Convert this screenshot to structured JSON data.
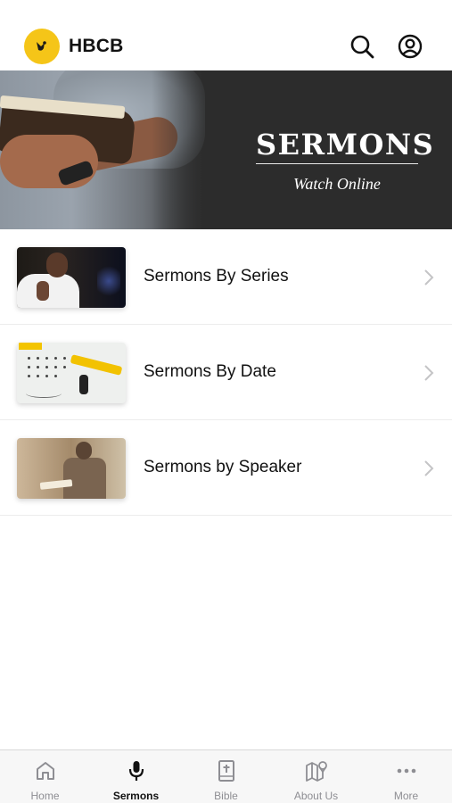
{
  "header": {
    "brand": "HBCB",
    "logo_icon": "bird-logo-icon",
    "search_icon": "search-icon",
    "profile_icon": "user-circle-icon",
    "logo_color": "#f5c518"
  },
  "banner": {
    "title": "SERMONS",
    "subtitle": "Watch Online"
  },
  "list": {
    "items": [
      {
        "label": "Sermons By Series",
        "thumb": "preacher-photo"
      },
      {
        "label": "Sermons By Date",
        "thumb": "calendar-photo"
      },
      {
        "label": "Sermons by Speaker",
        "thumb": "speaker-photo"
      }
    ]
  },
  "tabbar": {
    "tabs": [
      {
        "label": "Home",
        "icon": "home-icon",
        "active": false
      },
      {
        "label": "Sermons",
        "icon": "microphone-icon",
        "active": true
      },
      {
        "label": "Bible",
        "icon": "bible-icon",
        "active": false
      },
      {
        "label": "About Us",
        "icon": "map-icon",
        "active": false
      },
      {
        "label": "More",
        "icon": "more-icon",
        "active": false
      }
    ]
  }
}
